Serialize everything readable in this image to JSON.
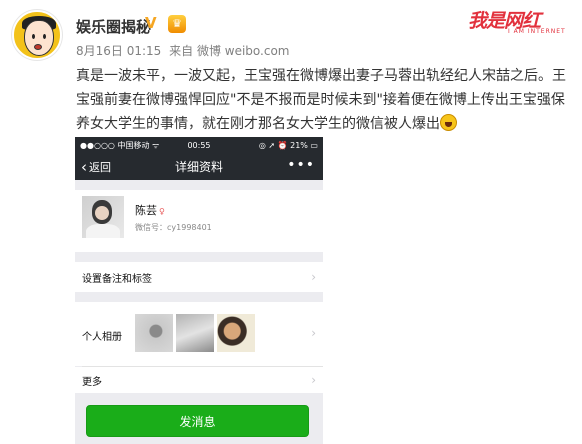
{
  "account": {
    "name": "娱乐圈揭秘",
    "verified_mark": "V"
  },
  "watermark": {
    "title": "我是网红",
    "subtitle": "I AM INTERNET"
  },
  "meta": {
    "date": "8月16日 01:15",
    "source": "来自 微博 weibo.com"
  },
  "post": {
    "text": "真是一波未平，一波又起，王宝强在微博爆出妻子马蓉出轨经纪人宋喆之后。王宝强前妻在微博强悍回应\"不是不报而是时候未到\"接着便在微博上传出王宝强保养女大学生的事情，就在刚才那名女大学生的微信被人爆出"
  },
  "phone": {
    "status": {
      "carrier": "●●○○○ 中国移动 ᯤ",
      "time": "00:55",
      "right": "◎ ➚ ⏰ 21% ▭"
    },
    "nav": {
      "back_chevron": "‹",
      "back_label": "返回",
      "title": "详细资料",
      "more": "•••"
    },
    "profile": {
      "name": "陈芸",
      "gender_icon": "♀",
      "wechat_label": "微信号：",
      "wechat_id": "cy1998401"
    },
    "rows": {
      "remark_label": "设置备注和标签",
      "album_label": "个人相册",
      "more_label": "更多",
      "chevron": "›"
    },
    "send_button": "发消息"
  }
}
